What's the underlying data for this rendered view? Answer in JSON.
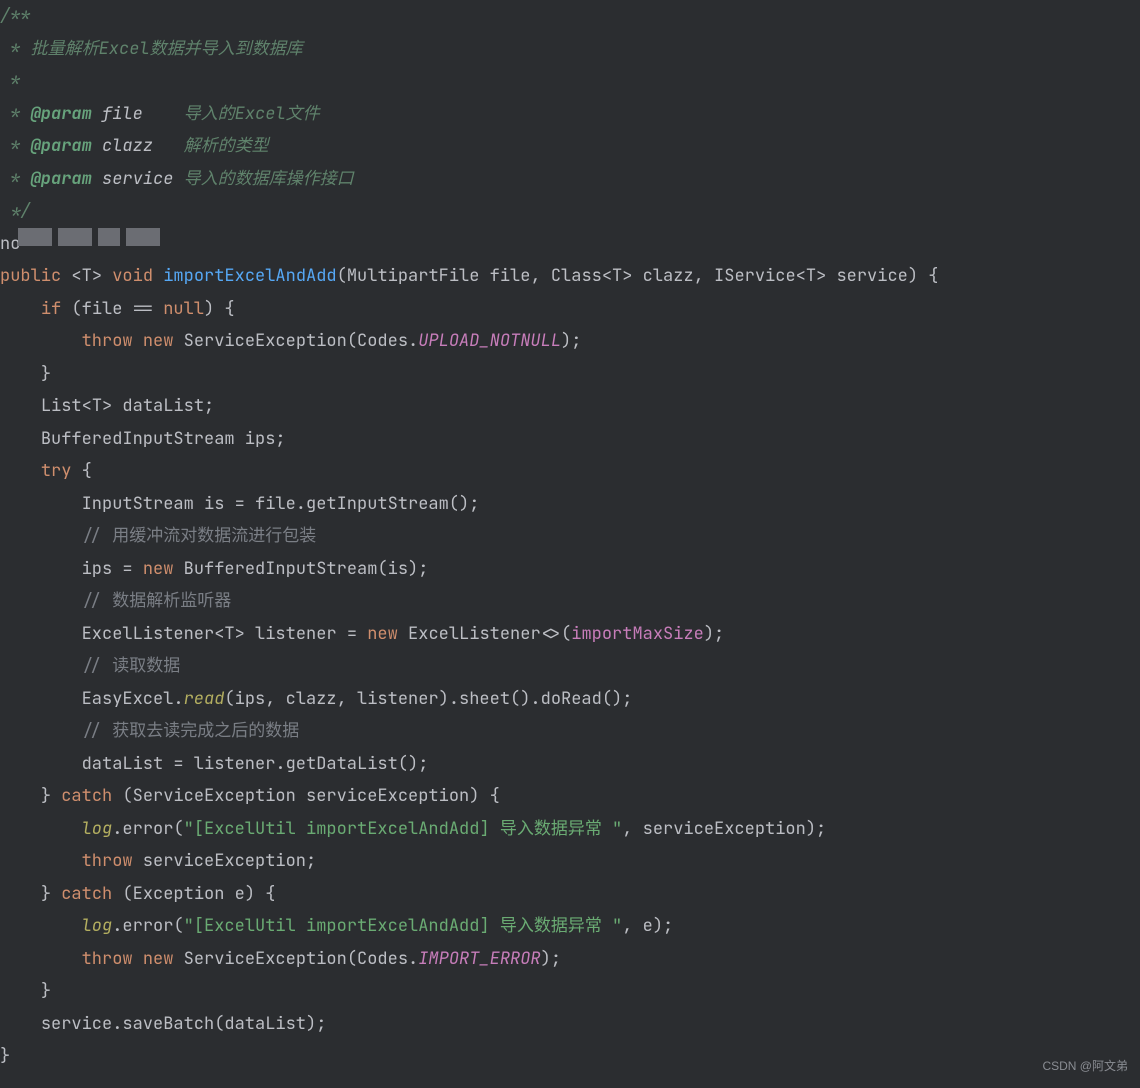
{
  "doc": {
    "open": "/**",
    "l1": " * 批量解析Excel数据并导入到数据库",
    "l2": " *",
    "l3_star": " * ",
    "tag": "@param",
    "p1_name": "file",
    "p1_desc": "导入的Excel文件",
    "p2_name": "clazz",
    "p2_desc": "解析的类型",
    "p3_name": "service",
    "p3_desc": "导入的数据库操作接口",
    "close": " */"
  },
  "anno_prefix": "no",
  "kw": {
    "public": "public",
    "void": "void",
    "if": "if",
    "null": "null",
    "throw": "throw",
    "new": "new",
    "try": "try",
    "catch": "catch"
  },
  "sig": {
    "method": "importExcelAndAdd",
    "p1": "(MultipartFile file, Class<",
    "T": "T",
    "p2": "> clazz, IService<",
    "p3": "> service) {"
  },
  "body": {
    "if_cond": " (file == ",
    "if_close": ") {",
    "svc_ex": " ServiceException(Codes.",
    "upload_notnull": "UPLOAD_NOTNULL",
    "close_call": ");",
    "brace_close": "}",
    "list_decl1": "List<",
    "list_decl2": "> dataList;",
    "bis_decl": "BufferedInputStream ips;",
    "try_open": " {",
    "is_line": "InputStream is = file.getInputStream();",
    "cmt1": "// 用缓冲流对数据流进行包装",
    "ips_assign1": "ips = ",
    "ips_assign2": " BufferedInputStream(is);",
    "cmt2": "// 数据解析监听器",
    "listener1": "ExcelListener<",
    "listener2": "> listener = ",
    "listener3": " ExcelListener<>(",
    "importMaxSize": "importMaxSize",
    "cmt3": "// 读取数据",
    "easy1": "EasyExcel.",
    "read": "read",
    "easy2": "(ips, clazz, listener).sheet().doRead();",
    "cmt4": "// 获取去读完成之后的数据",
    "datalist_assign": "dataList = listener.getDataList();",
    "catch1_open": " (ServiceException serviceException) {",
    "log": "log",
    "log_err1": ".error(",
    "log_str1": "\"[ExcelUtil importExcelAndAdd] 导入数据异常 \"",
    "log_err1_end": ", serviceException);",
    "throw_se": " serviceException;",
    "catch2_open": " (Exception e) {",
    "log_err2_end": ", e);",
    "import_error": "IMPORT_ERROR",
    "savebatch": "service.saveBatch(dataList);"
  },
  "watermark": "CSDN @阿文弟"
}
